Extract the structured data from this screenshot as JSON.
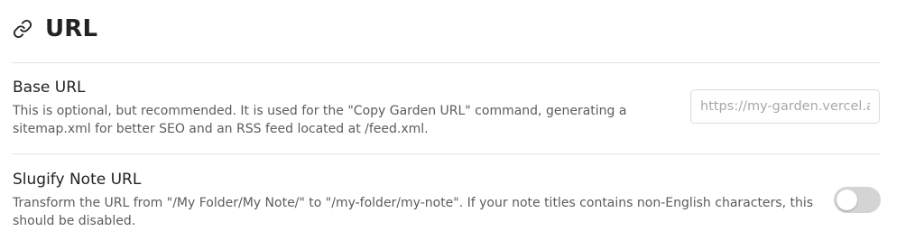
{
  "section": {
    "icon": "link-icon",
    "title": "URL"
  },
  "settings": {
    "base_url": {
      "name": "Base URL",
      "description": "This is optional, but recommended. It is used for the \"Copy Garden URL\" command, generating a sitemap.xml for better SEO and an RSS feed located at /feed.xml.",
      "input_value": "",
      "input_placeholder": "https://my-garden.vercel.app"
    },
    "slugify": {
      "name": "Slugify Note URL",
      "description": "Transform the URL from \"/My Folder/My Note/\" to \"/my-folder/my-note\". If your note titles contains non-English characters, this should be disabled.",
      "enabled": false
    }
  },
  "colors": {
    "toggle_off": "#d4d4d4",
    "divider": "#e4e4e4",
    "description_text": "#5c5c5c"
  }
}
